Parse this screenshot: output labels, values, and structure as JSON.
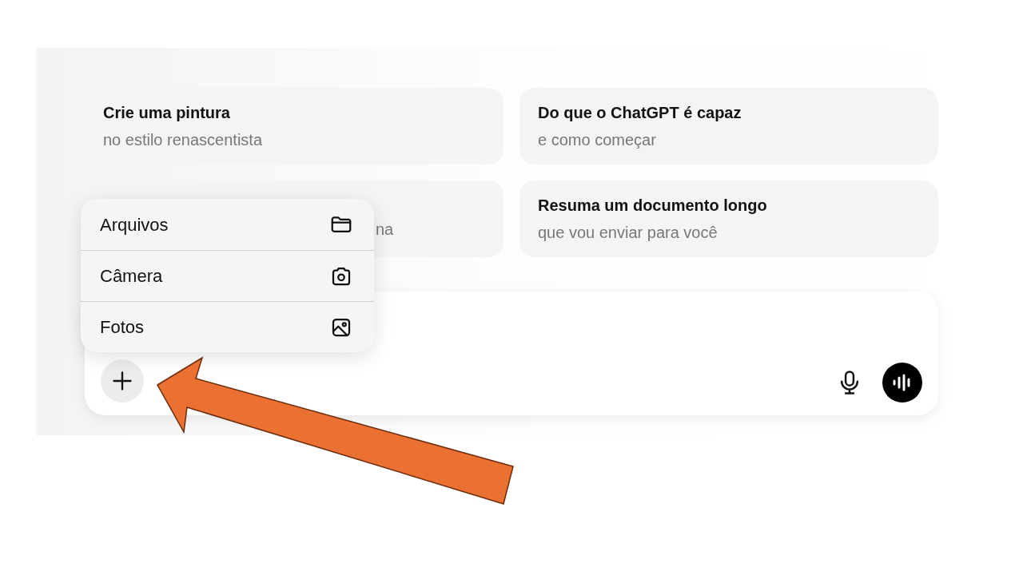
{
  "suggestions": [
    {
      "title": "Crie uma pintura",
      "subtitle": "no estilo renascentista"
    },
    {
      "title": "Do que o ChatGPT é capaz",
      "subtitle": "e como começar"
    },
    {
      "subtitle": "na"
    },
    {
      "title": "Resuma um documento longo",
      "subtitle": "que vou enviar para você"
    }
  ],
  "attach_menu": {
    "items": [
      {
        "label": "Arquivos",
        "kind": "folder"
      },
      {
        "label": "Câmera",
        "kind": "camera"
      },
      {
        "label": "Fotos",
        "kind": "photo"
      }
    ]
  }
}
